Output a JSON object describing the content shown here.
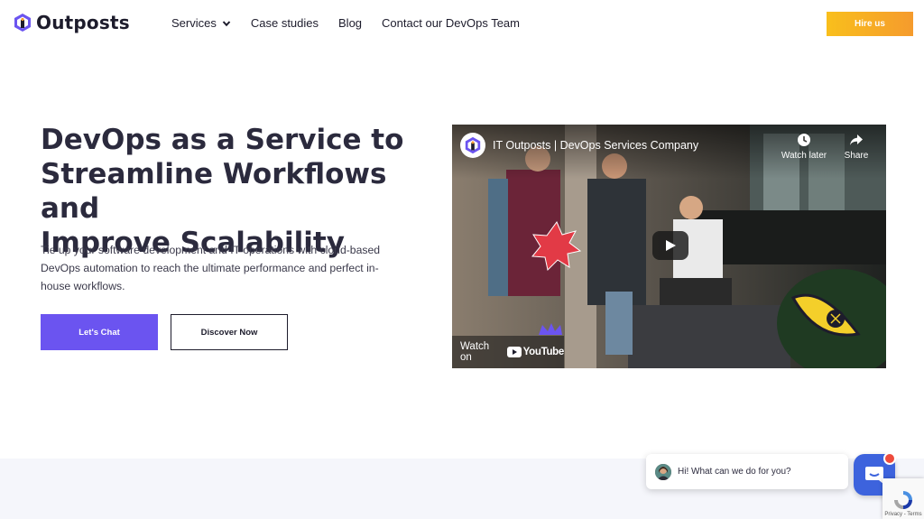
{
  "header": {
    "logo_text": "Outposts",
    "nav": [
      {
        "label": "Services",
        "has_dropdown": true
      },
      {
        "label": "Case studies"
      },
      {
        "label": "Blog"
      },
      {
        "label": "Contact our DevOps Team"
      }
    ],
    "hire_label": "Hire us"
  },
  "hero": {
    "title_lines": [
      "DevOps as a Service to",
      "Streamline Workflows and",
      "Improve Scalability"
    ],
    "description": "Tie up your software development and IT operations with cloud-based DevOps automation to reach the ultimate performance and perfect in-house workflows.",
    "primary_cta": "Let's Chat",
    "secondary_cta": "Discover Now"
  },
  "video": {
    "title": "IT Outposts | DevOps Services Company",
    "watch_later": "Watch later",
    "share": "Share",
    "watch_on": "Watch on",
    "youtube": "YouTube"
  },
  "chat": {
    "greeting": "Hi! What can we do for you?"
  },
  "recaptcha": {
    "label": "Privacy - Terms"
  },
  "colors": {
    "accent_purple": "#6b54f0",
    "hire_gradient_start": "#f9bf1c",
    "hire_gradient_end": "#f59b2d",
    "heading": "#2b2a3d",
    "chat_blue": "#3d63dd",
    "notification_red": "#ee4b3c"
  }
}
